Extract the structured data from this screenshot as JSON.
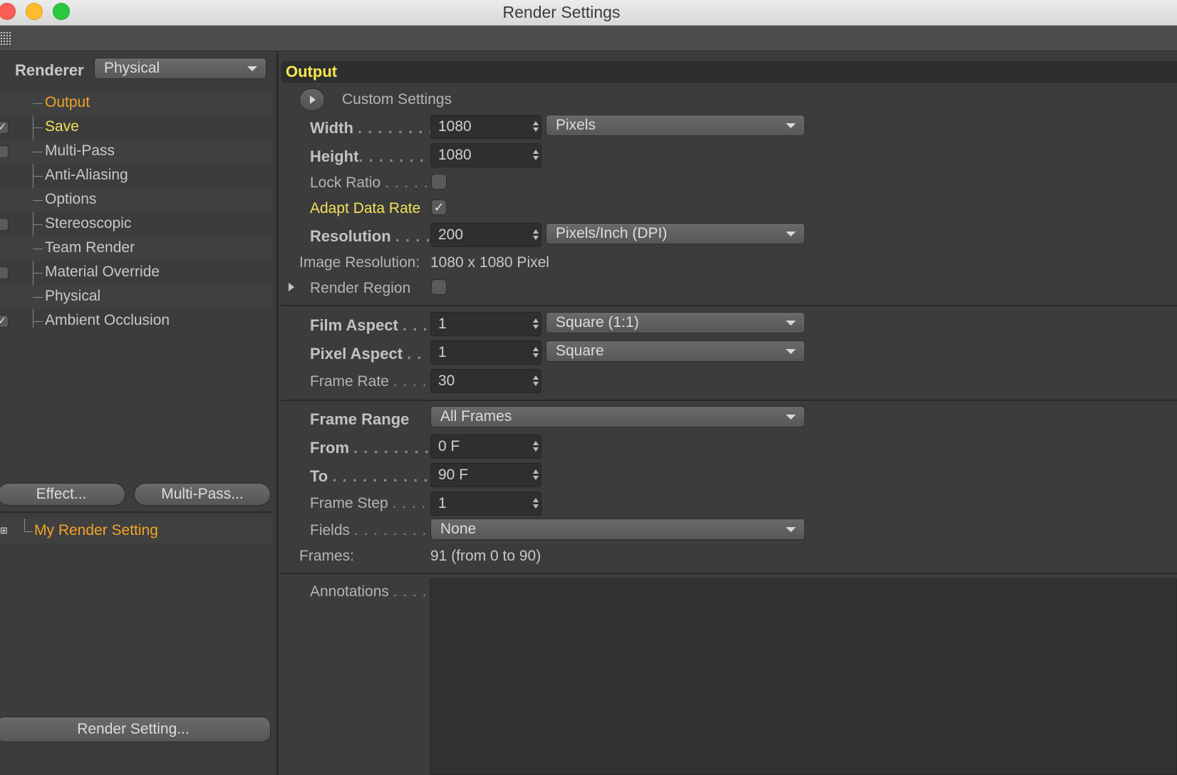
{
  "window": {
    "title": "Render Settings"
  },
  "left": {
    "renderer_label": "Renderer",
    "renderer_value": "Physical",
    "tree": [
      {
        "label": "Output",
        "state": "selected"
      },
      {
        "label": "Save",
        "state": "highlight",
        "checked": true
      },
      {
        "label": "Multi-Pass",
        "checked": false
      },
      {
        "label": "Anti-Aliasing"
      },
      {
        "label": "Options"
      },
      {
        "label": "Stereoscopic",
        "checked": false
      },
      {
        "label": "Team Render"
      },
      {
        "label": "Material Override",
        "checked": false
      },
      {
        "label": "Physical"
      },
      {
        "label": "Ambient Occlusion",
        "checked": true
      }
    ],
    "effect_button": "Effect...",
    "multipass_button": "Multi-Pass...",
    "render_setting_name": "My Render Setting",
    "render_setting_button": "Render Setting..."
  },
  "output": {
    "section_title": "Output",
    "custom_settings": "Custom Settings",
    "width_label": "Width",
    "width_dots": ". . . . . . . .",
    "width_value": "1080",
    "width_unit": "Pixels",
    "height_label": "Height",
    "height_dots": ". . . . . . . .",
    "height_value": "1080",
    "lock_ratio_label": "Lock Ratio",
    "lock_ratio_dots": ". . . . .",
    "lock_ratio_checked": false,
    "adapt_label": "Adapt Data Rate",
    "adapt_checked": true,
    "resolution_label": "Resolution",
    "resolution_dots": ". . . .",
    "resolution_value": "200",
    "resolution_unit": "Pixels/Inch (DPI)",
    "image_resolution_label": "Image Resolution:",
    "image_resolution_value": "1080 x 1080 Pixel",
    "render_region_label": "Render Region",
    "render_region_checked": false,
    "film_aspect_label": "Film Aspect",
    "film_aspect_dots": ". . .",
    "film_aspect_value": "1",
    "film_aspect_preset": "Square (1:1)",
    "pixel_aspect_label": "Pixel Aspect",
    "pixel_aspect_dots": ". .",
    "pixel_aspect_value": "1",
    "pixel_aspect_preset": "Square",
    "frame_rate_label": "Frame Rate",
    "frame_rate_dots": ". . . .",
    "frame_rate_value": "30",
    "frame_range_label": "Frame Range",
    "frame_range_value": "All Frames",
    "from_label": "From",
    "from_dots": ". . . . . . . . . .",
    "from_value": "0 F",
    "to_label": "To",
    "to_dots": ". . . . . . . . . . . .",
    "to_value": "90 F",
    "frame_step_label": "Frame Step",
    "frame_step_dots": ". . . .",
    "frame_step_value": "1",
    "fields_label": "Fields",
    "fields_dots": ". . . . . . . . . .",
    "fields_value": "None",
    "frames_label": "Frames:",
    "frames_value": "91 (from 0 to 90)",
    "annotations_label": "Annotations",
    "annotations_dots": ". . . ."
  },
  "colors": {
    "accent_orange": "#f2a32a",
    "accent_yellow": "#f5e05a",
    "panel": "#3c3c3c"
  }
}
